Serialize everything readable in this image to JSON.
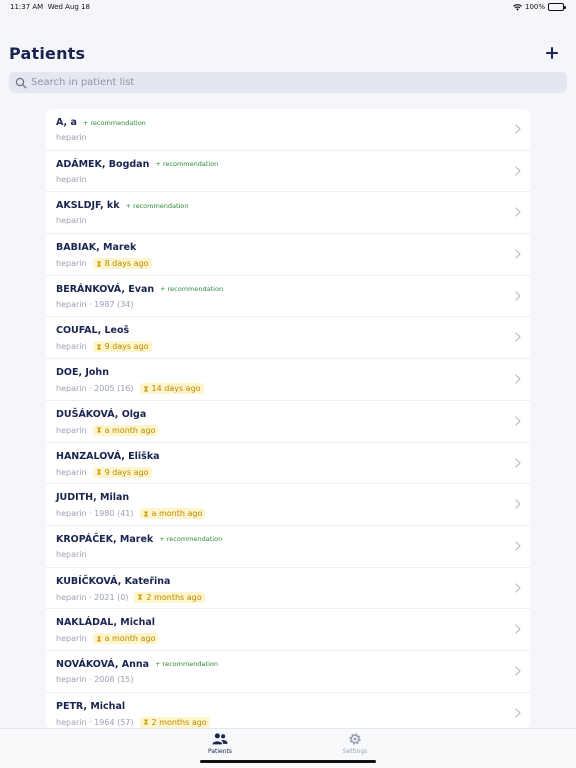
{
  "status_bar": {
    "time": "11:37 AM",
    "date": "Wed Aug 18",
    "battery": "100%",
    "wifi_icon": "wifi-icon",
    "battery_icon": "battery-icon"
  },
  "header": {
    "title": "Patients",
    "add_icon": "plus-icon"
  },
  "search": {
    "placeholder": "Search in patient list",
    "icon": "search-icon"
  },
  "patients": [
    {
      "name": "A, a",
      "recommendation": "+ recommendation",
      "sub": "heparin",
      "time": ""
    },
    {
      "name": "ADÁMEK, Bogdan",
      "recommendation": "+ recommendation",
      "sub": "heparin",
      "time": ""
    },
    {
      "name": "AKSLDJF, kk",
      "recommendation": "+ recommendation",
      "sub": "heparin",
      "time": ""
    },
    {
      "name": "BABIAK, Marek",
      "recommendation": "",
      "sub": "heparin",
      "time": "8 days ago"
    },
    {
      "name": "BERÁNKOVÁ, Evan",
      "recommendation": "+ recommendation",
      "sub": "heparin · 1987 (34)",
      "time": ""
    },
    {
      "name": "COUFAL, Leoš",
      "recommendation": "",
      "sub": "heparin",
      "time": "9 days ago"
    },
    {
      "name": "DOE, John",
      "recommendation": "",
      "sub": "heparin · 2005 (16)",
      "time": "14 days ago"
    },
    {
      "name": "DUŠÁKOVÁ, Olga",
      "recommendation": "",
      "sub": "heparin",
      "time": "a month ago"
    },
    {
      "name": "HANZALOVÁ, Eliška",
      "recommendation": "",
      "sub": "heparin",
      "time": "9 days ago"
    },
    {
      "name": "JUDITH, Milan",
      "recommendation": "",
      "sub": "heparin · 1980 (41)",
      "time": "a month ago"
    },
    {
      "name": "KROPÁČEK, Marek",
      "recommendation": "+ recommendation",
      "sub": "heparin",
      "time": ""
    },
    {
      "name": "KUBÍČKOVÁ, Kateřina",
      "recommendation": "",
      "sub": "heparin · 2021 (0)",
      "time": "2 months ago"
    },
    {
      "name": "NAKLÁDAL, Michal",
      "recommendation": "",
      "sub": "heparin",
      "time": "a month ago"
    },
    {
      "name": "NOVÁKOVÁ, Anna",
      "recommendation": "+ recommendation",
      "sub": "heparin · 2006 (15)",
      "time": ""
    },
    {
      "name": "PETR, Michal",
      "recommendation": "",
      "sub": "heparin · 1964 (57)",
      "time": "2 months ago"
    }
  ],
  "tabs": [
    {
      "label": "Patients",
      "icon": "people-icon",
      "active": true
    },
    {
      "label": "Settings",
      "icon": "gear-icon",
      "active": false
    }
  ],
  "colors": {
    "accent": "#1a2450",
    "recommendation": "#2e8b3d",
    "time_badge_bg": "#fff5cc",
    "time_badge_text": "#b88a00"
  }
}
